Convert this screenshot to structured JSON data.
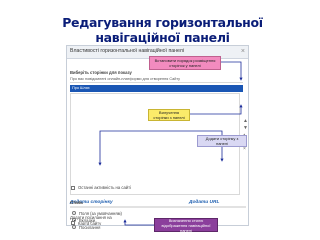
{
  "slide": {
    "title_line1": "Редагування горизонтальної",
    "title_line2": "навігаційної панелі"
  },
  "dialog": {
    "title": "Властивості горизонтальної навігаційної панелі",
    "close_icon": "close-icon",
    "select_label": "Виберіть сторінки для показу",
    "select_row": "Про вас повідомлені онлайн-платформи для створення Сайту",
    "selected_item": "Про Шлях",
    "add_page_link": "Додати сторінку",
    "add_url_link": "Додати URL",
    "add_section_label": "Додати посилання на",
    "checkboxes": [
      {
        "label": "Карта сайту",
        "checked": false
      },
      {
        "label": "Останні активність на сайті",
        "checked": false
      }
    ],
    "style_label": "Стиль",
    "radios": [
      {
        "label": "Поля (за умовчанням)",
        "selected": false
      },
      {
        "label": "Вкладки",
        "selected": true
      },
      {
        "label": "Посилання",
        "selected": false
      }
    ]
  },
  "callouts": {
    "pink": "Встановити порядок розміщення сторінок у панелі",
    "yellow": "Вилучення сторінки з панелі",
    "lavender": "Додати сторінку з панелі",
    "purple": "Визначення стилю відображення навігаційної панелі"
  },
  "colors": {
    "title": "#0a1d78",
    "selection": "#1a56b4",
    "link": "#1f5fb0",
    "callout_pink": "#f28bbf",
    "callout_yellow": "#fbeb6a",
    "callout_lavender": "#d9d8f3",
    "callout_purple": "#8b3f9c"
  }
}
